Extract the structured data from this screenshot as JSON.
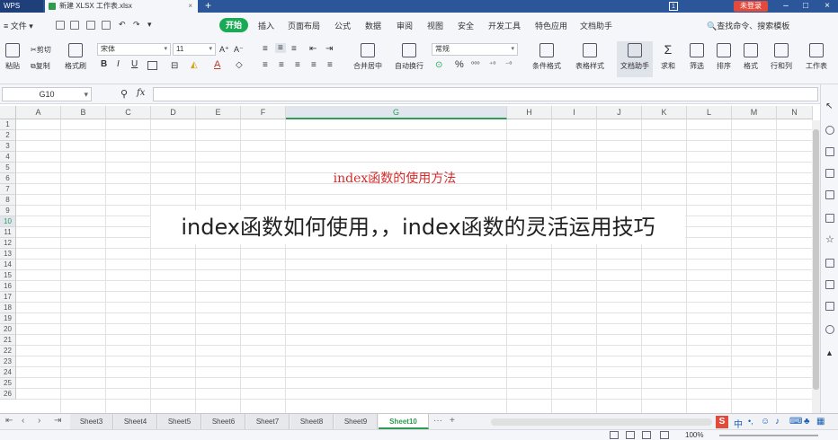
{
  "titlebar": {
    "brand": "WPS",
    "doc_tab": "新建 XLSX 工作表.xlsx",
    "page_number": "1",
    "login": "未登录"
  },
  "menu": {
    "file": "文件",
    "items": [
      "开始",
      "插入",
      "页面布局",
      "公式",
      "数据",
      "审阅",
      "视图",
      "安全",
      "开发工具",
      "特色应用",
      "文档助手"
    ],
    "search": "查找命令、搜索模板"
  },
  "ribbon": {
    "paste": "粘贴",
    "cut": "剪切",
    "copy": "复制",
    "format_painter": "格式刷",
    "font_name": "宋体",
    "font_size": "11",
    "bold": "B",
    "italic": "I",
    "underline": "U",
    "merge_center": "合并居中",
    "wrap_text": "自动换行",
    "number_format": "常规",
    "conditional_format": "条件格式",
    "table_style": "表格样式",
    "doc_assistant": "文档助手",
    "sum": "求和",
    "filter": "筛选",
    "sort": "排序",
    "format": "格式",
    "row_col": "行和列",
    "worksheet": "工作表",
    "percent": "%"
  },
  "formula_bar": {
    "name_box": "G10",
    "fx": "fx",
    "formula": ""
  },
  "grid": {
    "columns": [
      "A",
      "B",
      "C",
      "D",
      "E",
      "F",
      "G",
      "H",
      "I",
      "J",
      "K",
      "L",
      "M",
      "N"
    ],
    "selected_column": "G",
    "rows": [
      "1",
      "2",
      "3",
      "4",
      "5",
      "6",
      "7",
      "8",
      "9",
      "10",
      "11",
      "12",
      "13",
      "14",
      "15",
      "16",
      "17",
      "18",
      "19",
      "20",
      "21",
      "22",
      "23",
      "24",
      "25",
      "26"
    ],
    "selected_row": "10",
    "cell_g5": "index函数的使用方法"
  },
  "overlay_title": "index函数如何使用，，index函数的灵活运用技巧",
  "sheets": {
    "tabs": [
      "Sheet3",
      "Sheet4",
      "Sheet5",
      "Sheet6",
      "Sheet7",
      "Sheet8",
      "Sheet9",
      "Sheet10"
    ],
    "active": "Sheet10",
    "more": "···",
    "add": "+"
  },
  "ime": {
    "lang": "中"
  },
  "status": {
    "zoom": "100%"
  }
}
